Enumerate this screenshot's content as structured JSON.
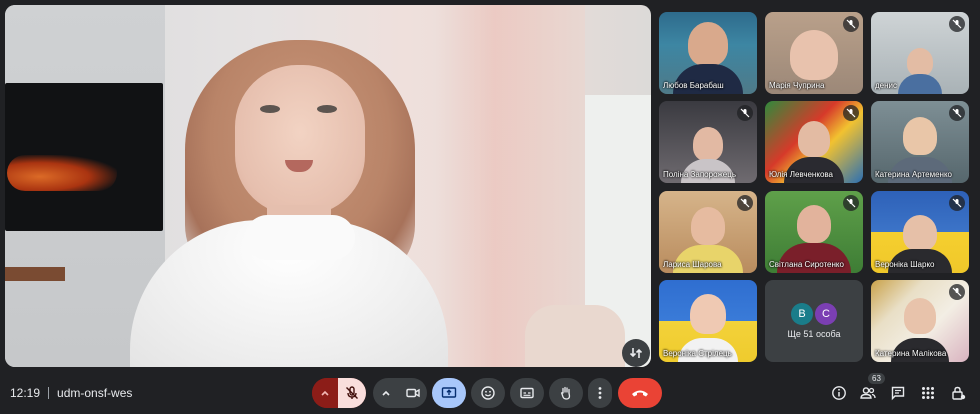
{
  "meeting": {
    "time": "12:19",
    "code": "udm-onsf-wes"
  },
  "participants": [
    {
      "name": "Любов Барабаш",
      "muted": false
    },
    {
      "name": "Марія Чуприна",
      "muted": true
    },
    {
      "name": "денис",
      "muted": true
    },
    {
      "name": "Поліна Запорожець",
      "muted": true
    },
    {
      "name": "Юлія Левченкова",
      "muted": true
    },
    {
      "name": "Катерина Артеменко",
      "muted": true
    },
    {
      "name": "Лариса Шарова",
      "muted": true
    },
    {
      "name": "Світлана Сиротенко",
      "muted": true
    },
    {
      "name": "Вероніка Шарко",
      "muted": true
    },
    {
      "name": "Вероніка Стрілець",
      "muted": false
    },
    {
      "name": "Катерина Малікова",
      "muted": true
    }
  ],
  "overflow": {
    "avatars": [
      {
        "letter": "B",
        "color": "#1a7d8a"
      },
      {
        "letter": "C",
        "color": "#7b3fb3"
      }
    ],
    "label": "Ще 51 особа"
  },
  "people_count": "63",
  "colors": {
    "end_call": "#ea4335",
    "mic_off_bg": "#f9dedc",
    "mic_arrow_bg": "#8c1d18",
    "present_bg": "#a8c7fa",
    "bar_bg": "#202124"
  },
  "controls": {
    "icons": [
      "chevron-up-icon",
      "mic-off-icon",
      "chevron-up-icon",
      "camera-icon",
      "present-icon",
      "emoji-icon",
      "captions-icon",
      "raise-hand-icon",
      "more-vert-icon",
      "end-call-icon"
    ]
  },
  "right_controls": {
    "icons": [
      "info-icon",
      "people-icon",
      "chat-icon",
      "apps-icon",
      "host-controls-icon"
    ]
  }
}
